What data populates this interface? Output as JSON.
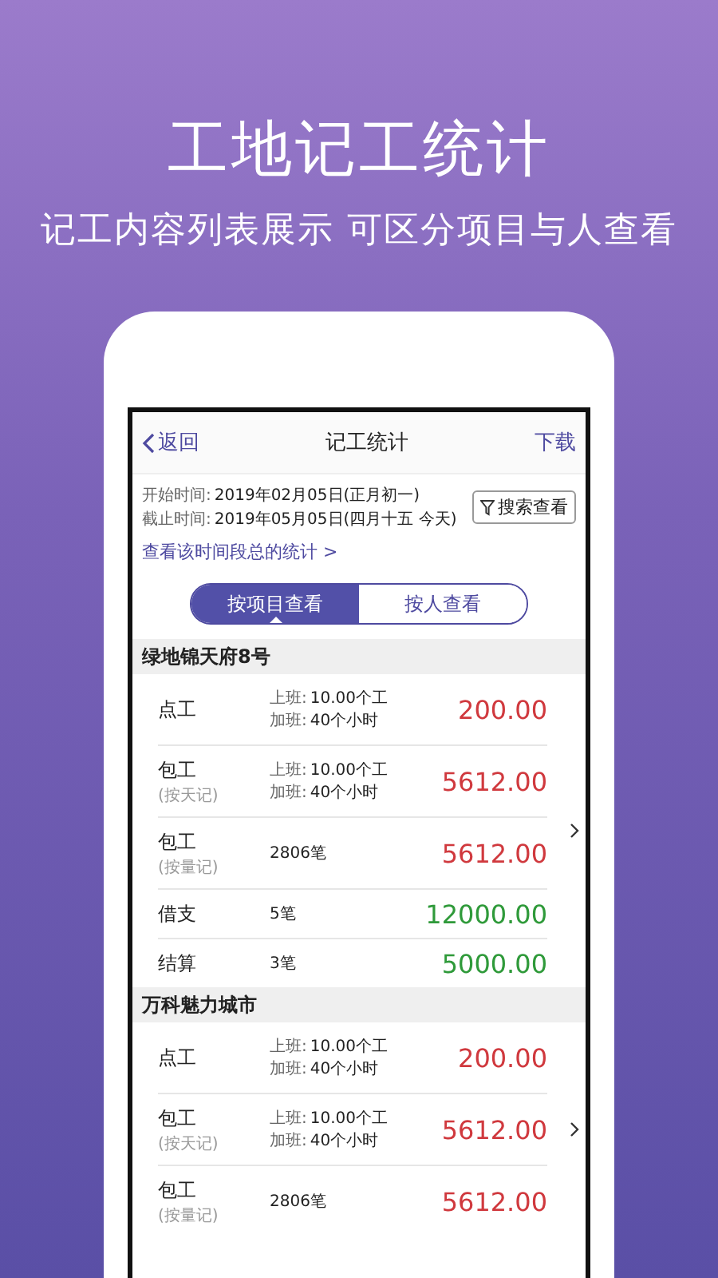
{
  "headline": "工地记工统计",
  "subheadline": "记工内容列表展示 可区分项目与人查看",
  "nav": {
    "back": "返回",
    "title": "记工统计",
    "action": "下载"
  },
  "period": {
    "start_label": "开始时间:",
    "start_value": "2019年02月05日(正月初一)",
    "end_label": "截止时间:",
    "end_value": "2019年05月05日(四月十五 今天)",
    "search_button": "搜索查看",
    "summary_link": "查看该时间段总的统计 >"
  },
  "tabs": [
    {
      "label": "按项目查看",
      "selected": true
    },
    {
      "label": "按人查看",
      "selected": false
    }
  ],
  "groups": [
    {
      "name": "绿地锦天府8号",
      "rows": [
        {
          "kind": "hours",
          "title": "点工",
          "details": [
            {
              "label": "上班:",
              "value": "10.00个工"
            },
            {
              "label": "加班:",
              "value": "40个小时"
            }
          ],
          "amount": "200.00",
          "color": "#d0393e"
        },
        {
          "kind": "hours",
          "title": "包工",
          "note": "(按天记)",
          "details": [
            {
              "label": "上班:",
              "value": "10.00个工"
            },
            {
              "label": "加班:",
              "value": "40个小时"
            }
          ],
          "amount": "5612.00",
          "color": "#d0393e"
        },
        {
          "kind": "count",
          "title": "包工",
          "note": "(按量记)",
          "count": "2806笔",
          "amount": "5612.00",
          "color": "#d0393e"
        },
        {
          "kind": "count",
          "title": "借支",
          "count": "5笔",
          "amount": "12000.00",
          "color": "#2f9a3a"
        },
        {
          "kind": "count",
          "title": "结算",
          "count": "3笔",
          "amount": "5000.00",
          "color": "#2f9a3a"
        }
      ]
    },
    {
      "name": "万科魅力城市",
      "rows": [
        {
          "kind": "hours",
          "title": "点工",
          "details": [
            {
              "label": "上班:",
              "value": "10.00个工"
            },
            {
              "label": "加班:",
              "value": "40个小时"
            }
          ],
          "amount": "200.00",
          "color": "#d0393e"
        },
        {
          "kind": "hours",
          "title": "包工",
          "note": "(按天记)",
          "details": [
            {
              "label": "上班:",
              "value": "10.00个工"
            },
            {
              "label": "加班:",
              "value": "40个小时"
            }
          ],
          "amount": "5612.00",
          "color": "#d0393e"
        },
        {
          "kind": "count",
          "title": "包工",
          "note": "(按量记)",
          "count": "2806笔",
          "amount": "5612.00",
          "color": "#d0393e"
        }
      ]
    }
  ]
}
